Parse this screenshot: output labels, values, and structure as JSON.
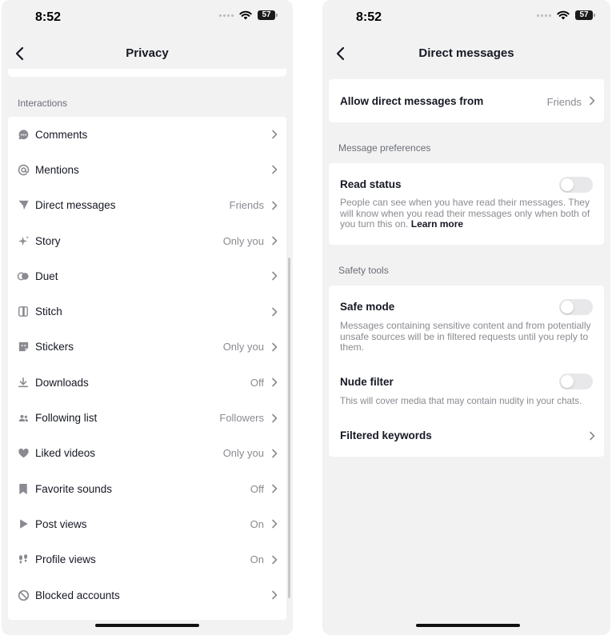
{
  "status_bar": {
    "time": "8:52",
    "battery": "57"
  },
  "privacy": {
    "title": "Privacy",
    "section_label": "Interactions",
    "items": [
      {
        "label": "Comments",
        "value": "",
        "icon": "comment-icon"
      },
      {
        "label": "Mentions",
        "value": "",
        "icon": "at-icon"
      },
      {
        "label": "Direct messages",
        "value": "Friends",
        "icon": "send-icon"
      },
      {
        "label": "Story",
        "value": "Only you",
        "icon": "sparkle-icon"
      },
      {
        "label": "Duet",
        "value": "",
        "icon": "duet-icon"
      },
      {
        "label": "Stitch",
        "value": "",
        "icon": "stitch-icon"
      },
      {
        "label": "Stickers",
        "value": "Only you",
        "icon": "sticker-icon"
      },
      {
        "label": "Downloads",
        "value": "Off",
        "icon": "download-icon"
      },
      {
        "label": "Following list",
        "value": "Followers",
        "icon": "people-icon"
      },
      {
        "label": "Liked videos",
        "value": "Only you",
        "icon": "heart-icon"
      },
      {
        "label": "Favorite sounds",
        "value": "Off",
        "icon": "bookmark-icon"
      },
      {
        "label": "Post views",
        "value": "On",
        "icon": "play-icon"
      },
      {
        "label": "Profile views",
        "value": "On",
        "icon": "footprints-icon"
      },
      {
        "label": "Blocked accounts",
        "value": "",
        "icon": "block-icon"
      }
    ]
  },
  "direct_messages": {
    "title": "Direct messages",
    "allow_from": {
      "label": "Allow direct messages from",
      "value": "Friends"
    },
    "message_preferences_label": "Message preferences",
    "read_status": {
      "title": "Read status",
      "description": "People can see when you have read their messages. They will know when you read their messages only when both of you turn this on.",
      "learn_more": "Learn more",
      "enabled": false
    },
    "safety_tools_label": "Safety tools",
    "safe_mode": {
      "title": "Safe mode",
      "description": "Messages containing sensitive content and from potentially unsafe sources will be in filtered requests until you reply to them.",
      "enabled": false
    },
    "nude_filter": {
      "title": "Nude filter",
      "description": "This will cover media that may contain nudity in your chats.",
      "enabled": false
    },
    "filtered_keywords": {
      "label": "Filtered keywords"
    }
  }
}
